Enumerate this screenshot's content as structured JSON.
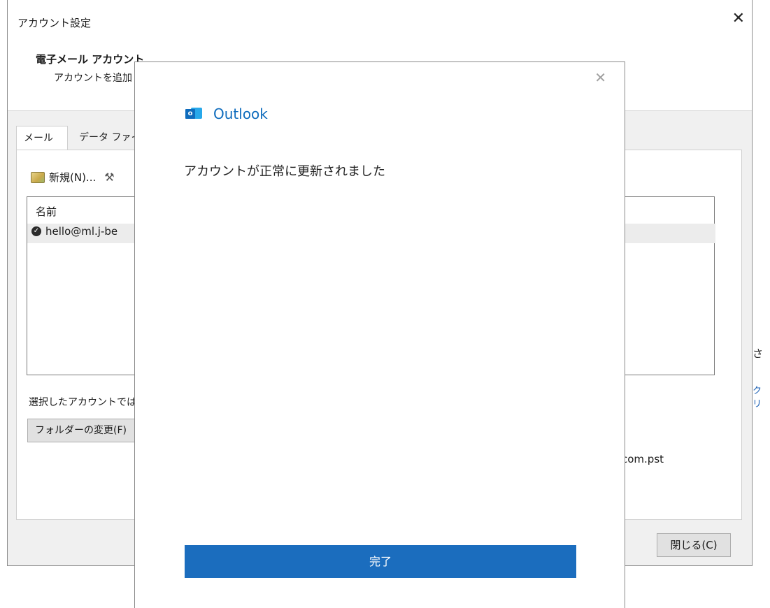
{
  "background_window": {
    "title": "アカウント設定",
    "section_heading": "電子メール アカウント",
    "section_sub": "アカウントを追加",
    "tabs": [
      {
        "label": "メール",
        "active": true
      },
      {
        "label": "データ ファイル",
        "active": false
      }
    ],
    "toolbar": {
      "new_label": "新規(N)..."
    },
    "list": {
      "column_header": "名前",
      "rows": [
        {
          "name": "hello@ml.j-be"
        }
      ]
    },
    "selected_text": "選択したアカウントでは",
    "folder_button": "フォルダーの変更(F)",
    "pst_text": "com.pst",
    "side_text_1": "さ",
    "side_text_2": "クリ",
    "close_button": "閉じる(C)"
  },
  "dialog": {
    "brand": "Outlook",
    "brand_icon_letter": "o",
    "message": "アカウントが正常に更新されました",
    "done_button": "完了",
    "accent_color": "#1b6dbe"
  }
}
